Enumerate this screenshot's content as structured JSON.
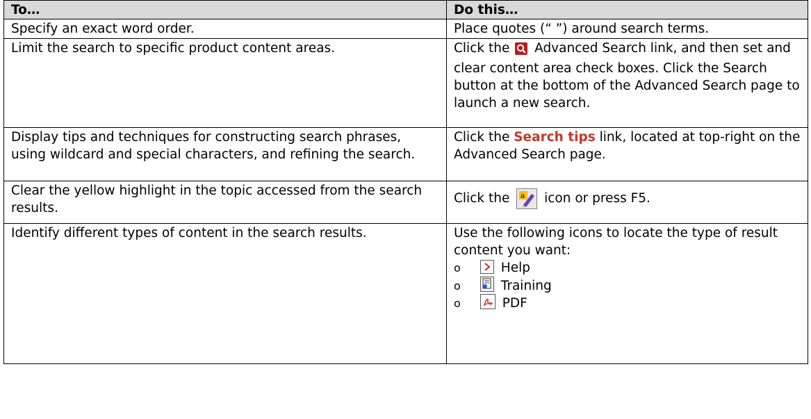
{
  "table": {
    "header": {
      "col1": "To…",
      "col2": "Do this…"
    },
    "rows": [
      {
        "to": "Specify an exact word order.",
        "do": "Place quotes (“ ”) around search terms."
      },
      {
        "to": "Limit the search to specific product content areas.",
        "do_prefix": "Click the",
        "do_icon": "advanced-search-icon",
        "do_suffix": "Advanced Search link, and then set and clear content area check boxes. Click the Search button at the bottom of the Advanced Search page to launch a new search."
      },
      {
        "to": "Display tips and techniques for constructing search phrases, using wildcard and special characters, and refining the search.",
        "do_prefix": "Click the",
        "do_link": "Search tips",
        "do_suffix": "link, located at top-right on the Advanced Search page."
      },
      {
        "to": "Clear the yellow highlight in the topic accessed from the search results.",
        "do_prefix": "Click the",
        "do_icon": "clear-highlight-icon",
        "do_suffix": "icon or press F5."
      },
      {
        "to": "Identify different types of content in the search results.",
        "do_intro": "Use the following icons to locate the type of result content you want:",
        "bullet": "o",
        "items": [
          {
            "label": "Help",
            "icon": "help-topic-icon"
          },
          {
            "label": "Training",
            "icon": "training-doc-icon"
          },
          {
            "label": "PDF",
            "icon": "pdf-icon"
          }
        ]
      }
    ]
  },
  "colors": {
    "header_bg": "#d9d9d9",
    "link_red": "#c0392b",
    "border": "#000000"
  }
}
